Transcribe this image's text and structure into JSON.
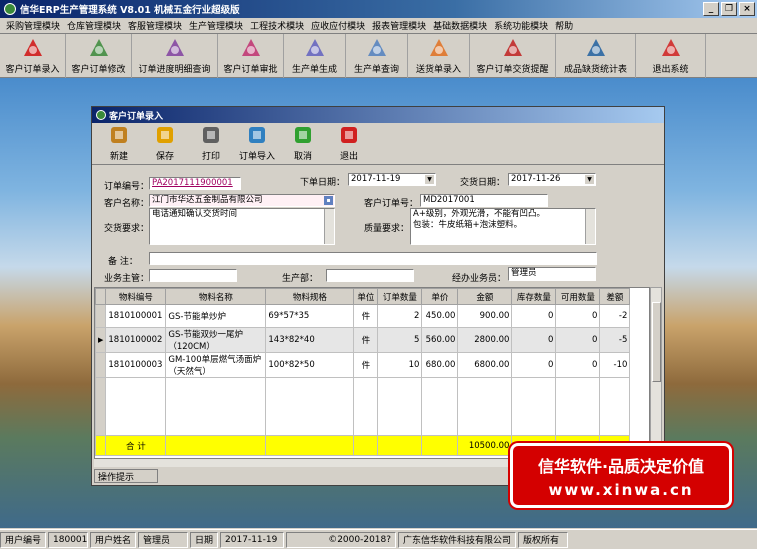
{
  "app": {
    "title": "信华ERP生产管理系统   V8.01  机械五金行业超级版"
  },
  "window_buttons": {
    "minimize": "_",
    "restore": "❐",
    "close": "×"
  },
  "menu": [
    "采购管理模块",
    "仓库管理模块",
    "客服管理模块",
    "生产管理模块",
    "工程技术模块",
    "应收应付模块",
    "报表管理模块",
    "基础数据模块",
    "系统功能模块",
    "帮助"
  ],
  "toolbar": [
    {
      "label": "客户订单录入",
      "icon": "pdf-icon",
      "color": "#d01010",
      "w": 66
    },
    {
      "label": "客户订单修改",
      "icon": "wand-icon",
      "color": "#3a8a3a",
      "w": 66
    },
    {
      "label": "订单进度明细查询",
      "icon": "pen-icon",
      "color": "#8040a0",
      "w": 86
    },
    {
      "label": "客户订单审批",
      "icon": "swan-icon",
      "color": "#c03070",
      "w": 66
    },
    {
      "label": "生产单生成",
      "icon": "crane-icon",
      "color": "#6060c0",
      "w": 62
    },
    {
      "label": "生产单查询",
      "icon": "bird-icon",
      "color": "#5080c0",
      "w": 62
    },
    {
      "label": "送货单录入",
      "icon": "flower-icon",
      "color": "#e07020",
      "w": 62
    },
    {
      "label": "客户订单交货提醒",
      "icon": "ribbon-icon",
      "color": "#c02020",
      "w": 86
    },
    {
      "label": "成品缺货统计表",
      "icon": "feather-icon",
      "color": "#2060a0",
      "w": 80
    },
    {
      "label": "退出系统",
      "icon": "power-icon",
      "color": "#d02020",
      "w": 70
    }
  ],
  "order_window": {
    "title": "客户订单录入",
    "buttons": [
      {
        "label": "新建",
        "icon": "clipboard-icon",
        "color": "#c08020"
      },
      {
        "label": "保存",
        "icon": "floppy-icon",
        "color": "#e0a000"
      },
      {
        "label": "打印",
        "icon": "printer-icon",
        "color": "#606060"
      },
      {
        "label": "订单导入",
        "icon": "import-icon",
        "color": "#3080c0"
      },
      {
        "label": "取消",
        "icon": "refresh-icon",
        "color": "#30a030"
      },
      {
        "label": "退出",
        "icon": "power-icon",
        "color": "#d02020"
      }
    ],
    "fields": {
      "order_no_label": "订单编号：",
      "order_no": "PA2017111900001",
      "order_date_label": "下单日期：",
      "order_date": "2017-11-19",
      "delivery_date_label": "交货日期：",
      "delivery_date": "2017-11-26",
      "customer_label": "客户名称：",
      "customer": "江门市华达五金制品有限公司",
      "customer_order_label": "客户订单号：",
      "customer_order": "MD2017001",
      "delivery_req_label": "交货要求：",
      "delivery_req": "电话通知确认交货时间",
      "quality_req_label": "质量要求：",
      "quality_req_line1": "A+级别，外观光滑，不能有凹凸。",
      "quality_req_line2": "包装：牛皮纸箱+泡沫塑料。",
      "remark_label": "备   注：",
      "supervisor_label": "业务主管：",
      "dept_label": "生产部：",
      "handler_label": "经办业务员：",
      "handler": "管理员"
    },
    "grid": {
      "headers": [
        "物料编号",
        "物料名称",
        "物料规格",
        "单位",
        "订单数量",
        "单价",
        "金额",
        "库存数量",
        "可用数量",
        "差额"
      ],
      "rows": [
        {
          "code": "1810100001",
          "name": "GS-节能单炒炉",
          "spec": "69*57*35",
          "unit": "件",
          "qty": "2",
          "price": "450.00",
          "amount": "900.00",
          "stock": "0",
          "avail": "0",
          "diff": "-2"
        },
        {
          "code": "1810100002",
          "name": "GS-节能双炒一尾炉（120CM）",
          "spec": "143*82*40",
          "unit": "件",
          "qty": "5",
          "price": "560.00",
          "amount": "2800.00",
          "stock": "0",
          "avail": "0",
          "diff": "-5"
        },
        {
          "code": "1810100003",
          "name": "GM-100单层燃气汤面炉（天然气）",
          "spec": "100*82*50",
          "unit": "件",
          "qty": "10",
          "price": "680.00",
          "amount": "6800.00",
          "stock": "0",
          "avail": "0",
          "diff": "-10"
        }
      ],
      "total_label": "合 计",
      "total_amount": "10500.00"
    },
    "tip_label": "操作提示"
  },
  "promo": {
    "line1": "信华软件·品质决定价值",
    "line2": "www.xinwa.cn"
  },
  "statusbar": {
    "user_no_label": "用户编号",
    "user_no": "180001",
    "user_name_label": "用户姓名",
    "user_name": "管理员",
    "date_label": "日期",
    "date": "2017-11-19",
    "copyright": "©2000-2018?",
    "company": "广东信华软件科技有限公司",
    "rights": "版权所有"
  }
}
